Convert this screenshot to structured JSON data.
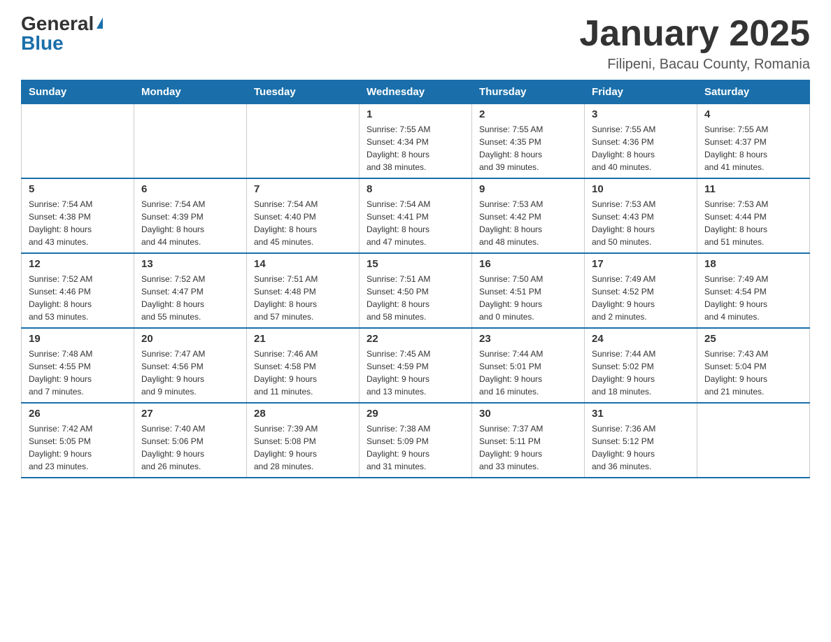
{
  "logo": {
    "general": "General",
    "blue": "Blue",
    "triangle": "▲"
  },
  "header": {
    "title": "January 2025",
    "subtitle": "Filipeni, Bacau County, Romania"
  },
  "weekdays": [
    "Sunday",
    "Monday",
    "Tuesday",
    "Wednesday",
    "Thursday",
    "Friday",
    "Saturday"
  ],
  "weeks": [
    [
      {
        "day": "",
        "info": ""
      },
      {
        "day": "",
        "info": ""
      },
      {
        "day": "",
        "info": ""
      },
      {
        "day": "1",
        "info": "Sunrise: 7:55 AM\nSunset: 4:34 PM\nDaylight: 8 hours\nand 38 minutes."
      },
      {
        "day": "2",
        "info": "Sunrise: 7:55 AM\nSunset: 4:35 PM\nDaylight: 8 hours\nand 39 minutes."
      },
      {
        "day": "3",
        "info": "Sunrise: 7:55 AM\nSunset: 4:36 PM\nDaylight: 8 hours\nand 40 minutes."
      },
      {
        "day": "4",
        "info": "Sunrise: 7:55 AM\nSunset: 4:37 PM\nDaylight: 8 hours\nand 41 minutes."
      }
    ],
    [
      {
        "day": "5",
        "info": "Sunrise: 7:54 AM\nSunset: 4:38 PM\nDaylight: 8 hours\nand 43 minutes."
      },
      {
        "day": "6",
        "info": "Sunrise: 7:54 AM\nSunset: 4:39 PM\nDaylight: 8 hours\nand 44 minutes."
      },
      {
        "day": "7",
        "info": "Sunrise: 7:54 AM\nSunset: 4:40 PM\nDaylight: 8 hours\nand 45 minutes."
      },
      {
        "day": "8",
        "info": "Sunrise: 7:54 AM\nSunset: 4:41 PM\nDaylight: 8 hours\nand 47 minutes."
      },
      {
        "day": "9",
        "info": "Sunrise: 7:53 AM\nSunset: 4:42 PM\nDaylight: 8 hours\nand 48 minutes."
      },
      {
        "day": "10",
        "info": "Sunrise: 7:53 AM\nSunset: 4:43 PM\nDaylight: 8 hours\nand 50 minutes."
      },
      {
        "day": "11",
        "info": "Sunrise: 7:53 AM\nSunset: 4:44 PM\nDaylight: 8 hours\nand 51 minutes."
      }
    ],
    [
      {
        "day": "12",
        "info": "Sunrise: 7:52 AM\nSunset: 4:46 PM\nDaylight: 8 hours\nand 53 minutes."
      },
      {
        "day": "13",
        "info": "Sunrise: 7:52 AM\nSunset: 4:47 PM\nDaylight: 8 hours\nand 55 minutes."
      },
      {
        "day": "14",
        "info": "Sunrise: 7:51 AM\nSunset: 4:48 PM\nDaylight: 8 hours\nand 57 minutes."
      },
      {
        "day": "15",
        "info": "Sunrise: 7:51 AM\nSunset: 4:50 PM\nDaylight: 8 hours\nand 58 minutes."
      },
      {
        "day": "16",
        "info": "Sunrise: 7:50 AM\nSunset: 4:51 PM\nDaylight: 9 hours\nand 0 minutes."
      },
      {
        "day": "17",
        "info": "Sunrise: 7:49 AM\nSunset: 4:52 PM\nDaylight: 9 hours\nand 2 minutes."
      },
      {
        "day": "18",
        "info": "Sunrise: 7:49 AM\nSunset: 4:54 PM\nDaylight: 9 hours\nand 4 minutes."
      }
    ],
    [
      {
        "day": "19",
        "info": "Sunrise: 7:48 AM\nSunset: 4:55 PM\nDaylight: 9 hours\nand 7 minutes."
      },
      {
        "day": "20",
        "info": "Sunrise: 7:47 AM\nSunset: 4:56 PM\nDaylight: 9 hours\nand 9 minutes."
      },
      {
        "day": "21",
        "info": "Sunrise: 7:46 AM\nSunset: 4:58 PM\nDaylight: 9 hours\nand 11 minutes."
      },
      {
        "day": "22",
        "info": "Sunrise: 7:45 AM\nSunset: 4:59 PM\nDaylight: 9 hours\nand 13 minutes."
      },
      {
        "day": "23",
        "info": "Sunrise: 7:44 AM\nSunset: 5:01 PM\nDaylight: 9 hours\nand 16 minutes."
      },
      {
        "day": "24",
        "info": "Sunrise: 7:44 AM\nSunset: 5:02 PM\nDaylight: 9 hours\nand 18 minutes."
      },
      {
        "day": "25",
        "info": "Sunrise: 7:43 AM\nSunset: 5:04 PM\nDaylight: 9 hours\nand 21 minutes."
      }
    ],
    [
      {
        "day": "26",
        "info": "Sunrise: 7:42 AM\nSunset: 5:05 PM\nDaylight: 9 hours\nand 23 minutes."
      },
      {
        "day": "27",
        "info": "Sunrise: 7:40 AM\nSunset: 5:06 PM\nDaylight: 9 hours\nand 26 minutes."
      },
      {
        "day": "28",
        "info": "Sunrise: 7:39 AM\nSunset: 5:08 PM\nDaylight: 9 hours\nand 28 minutes."
      },
      {
        "day": "29",
        "info": "Sunrise: 7:38 AM\nSunset: 5:09 PM\nDaylight: 9 hours\nand 31 minutes."
      },
      {
        "day": "30",
        "info": "Sunrise: 7:37 AM\nSunset: 5:11 PM\nDaylight: 9 hours\nand 33 minutes."
      },
      {
        "day": "31",
        "info": "Sunrise: 7:36 AM\nSunset: 5:12 PM\nDaylight: 9 hours\nand 36 minutes."
      },
      {
        "day": "",
        "info": ""
      }
    ]
  ]
}
